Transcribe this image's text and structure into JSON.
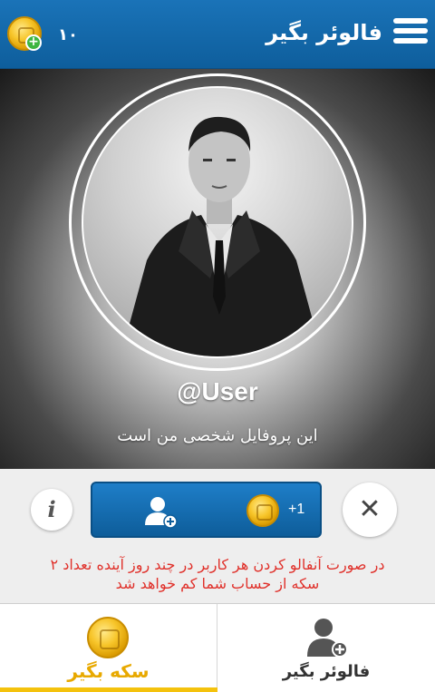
{
  "header": {
    "title": "فالوئر بگیر",
    "coin_count": "۱۰",
    "menu_icon": "hamburger-menu-icon",
    "wallet_icon": "coin-add-icon"
  },
  "profile": {
    "username": "@User",
    "bio": "این پروفایل شخصی من است"
  },
  "actions": {
    "reward_label": "+1",
    "info_glyph": "i",
    "skip_glyph": "✕"
  },
  "warning": {
    "line1": "در صورت آنفالو کردن هر کاربر در چند روز آینده تعداد ۲",
    "line2": "سکه از حساب شما کم خواهد شد"
  },
  "tabs": [
    {
      "label": "سکه بگیر",
      "icon": "coin-icon",
      "active": true
    },
    {
      "label": "فالوئر بگیر",
      "icon": "user-add-icon",
      "active": false
    }
  ],
  "colors": {
    "primary": "#1572bb",
    "accent": "#f4c20d",
    "warning": "#e0312b"
  }
}
